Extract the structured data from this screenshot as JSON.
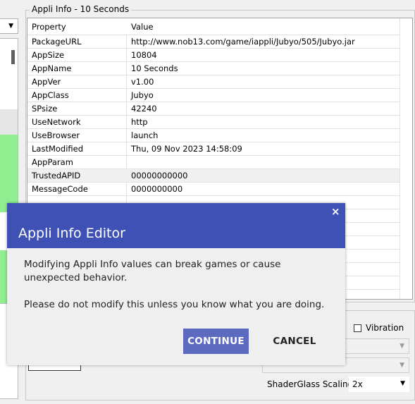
{
  "group_title": "Appli Info - 10 Seconds",
  "grid": {
    "header": {
      "property": "Property",
      "value": "Value"
    },
    "rows": [
      {
        "property": "PackageURL",
        "value": "http://www.nob13.com/game/iappli/Jubyo/505/Jubyo.jar"
      },
      {
        "property": "AppSize",
        "value": "10804"
      },
      {
        "property": "AppName",
        "value": "10 Seconds"
      },
      {
        "property": "AppVer",
        "value": "v1.00"
      },
      {
        "property": "AppClass",
        "value": "Jubyo"
      },
      {
        "property": "SPsize",
        "value": "42240"
      },
      {
        "property": "UseNetwork",
        "value": "http"
      },
      {
        "property": "UseBrowser",
        "value": "launch"
      },
      {
        "property": "LastModified",
        "value": "Thu, 09 Nov 2023 14:58:09"
      },
      {
        "property": "AppParam",
        "value": ""
      },
      {
        "property": "TrustedAPID",
        "value": "00000000000"
      },
      {
        "property": "MessageCode",
        "value": "0000000000"
      }
    ]
  },
  "vibration_label": "Vibration",
  "shader": {
    "label": "ShaderGlass Scaling",
    "value": "2x"
  },
  "dialog": {
    "title": "Appli Info Editor",
    "message1": "Modifying Appli Info values can break games or cause unexpected behavior.",
    "message2": "Please do not modify this unless you know what you are doing.",
    "continue_label": "CONTINUE",
    "cancel_label": "CANCEL",
    "close_glyph": "×"
  },
  "colors": {
    "dialog_header": "#3f51b5",
    "continue_button": "#5c6bc0",
    "highlight_green": "#90ee90"
  },
  "icons": {
    "dropdown": "chevron-down-icon",
    "close": "close-icon"
  }
}
